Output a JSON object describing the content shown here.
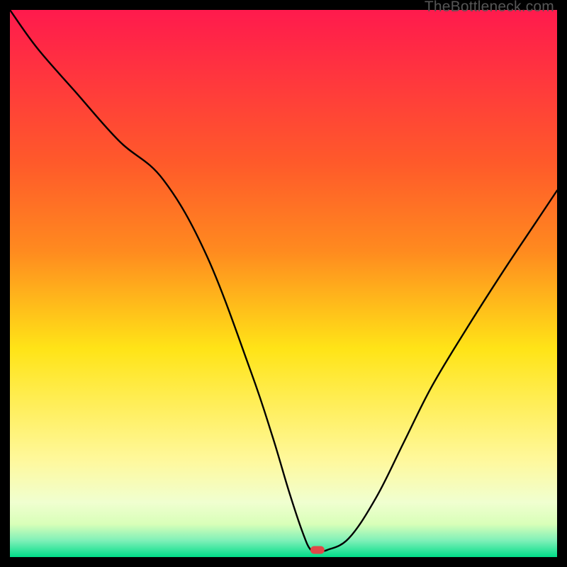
{
  "watermark": "TheBottleneck.com",
  "chart_data": {
    "type": "line",
    "title": "",
    "xlabel": "",
    "ylabel": "",
    "xlim": [
      0,
      100
    ],
    "ylim": [
      0,
      100
    ],
    "colors": {
      "top": "#ff1a4d",
      "mid_upper": "#ff8a1f",
      "mid": "#ffe417",
      "mid_lower": "#fff89a",
      "near_bottom": "#d8ffb8",
      "bottom": "#00dd88",
      "line": "#000000",
      "marker": "#e04848",
      "frame": "#000000"
    },
    "series": [
      {
        "name": "bottleneck-curve",
        "x": [
          0,
          5,
          12,
          20,
          28,
          36,
          44,
          48,
          51,
          53.5,
          55,
          56.5,
          58,
          62,
          67,
          72,
          77,
          83,
          90,
          96,
          100
        ],
        "y": [
          100,
          93,
          85,
          76,
          69,
          55,
          34,
          22,
          12,
          4.5,
          1.3,
          1.3,
          1.3,
          3.5,
          11,
          21,
          31,
          41,
          52,
          61,
          67
        ]
      }
    ],
    "marker": {
      "x": 56.2,
      "y": 1.3,
      "name": "optimal-point"
    }
  }
}
